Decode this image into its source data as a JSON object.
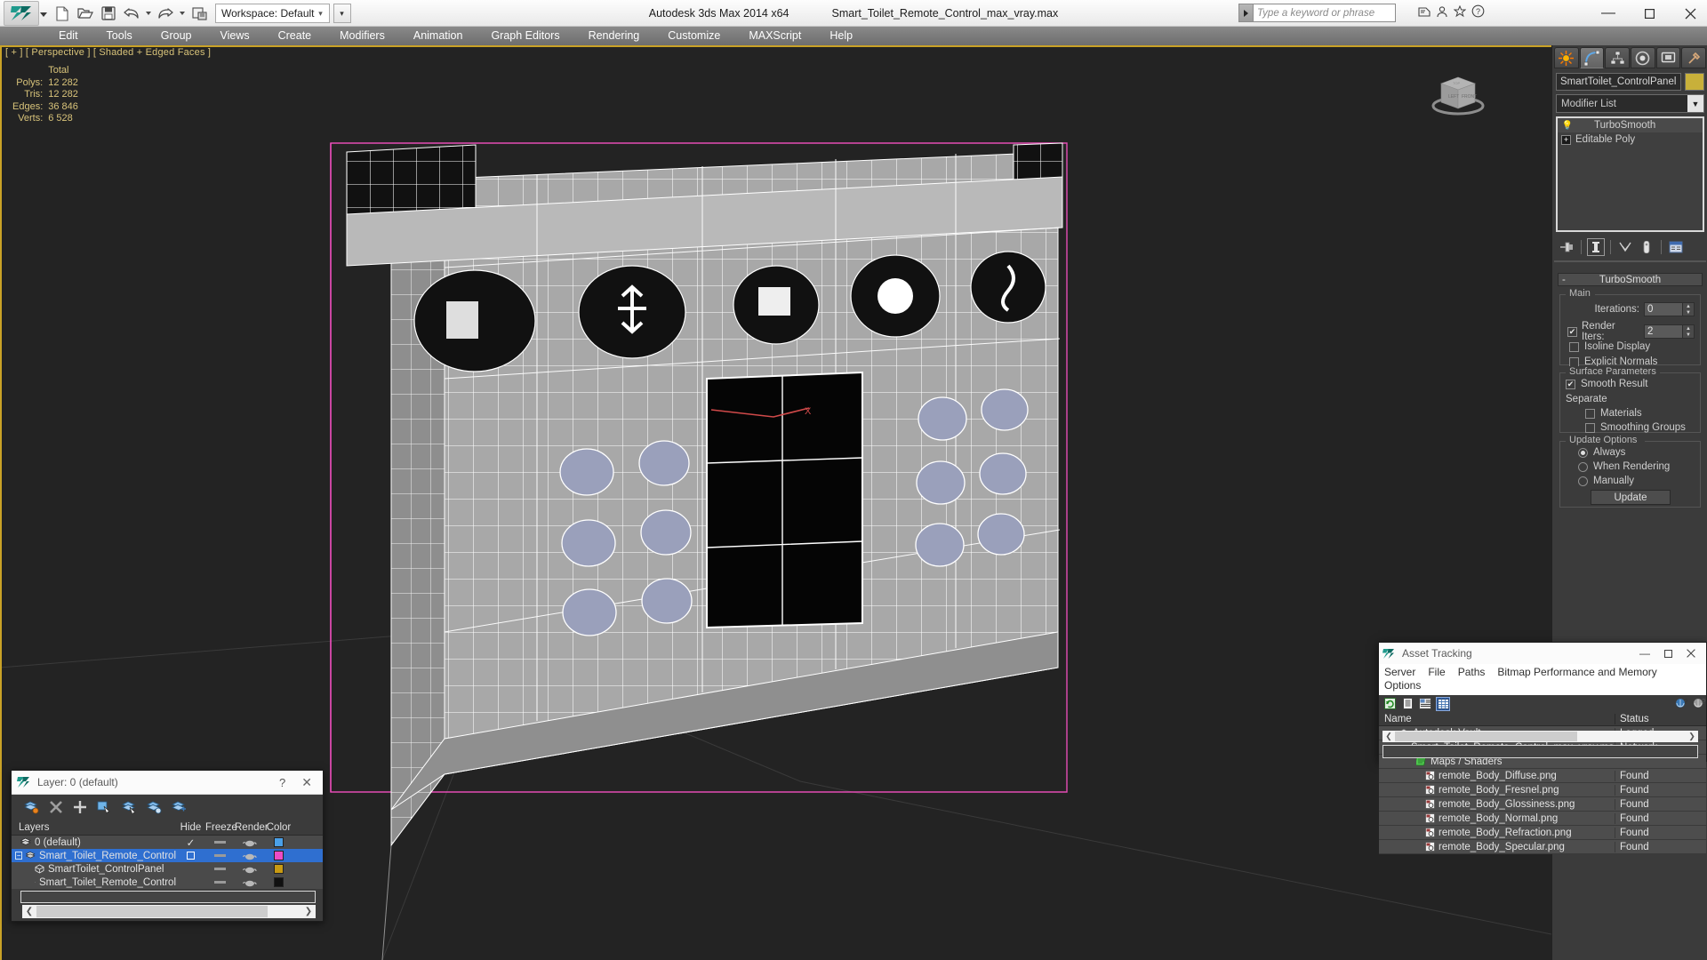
{
  "titlebar": {
    "app_title": "Autodesk 3ds Max  2014 x64",
    "file_title": "Smart_Toilet_Remote_Control_max_vray.max",
    "workspace_label": "Workspace: Default",
    "workspace_dropdown": "▾",
    "workspace_more": "▾",
    "quick_access": [
      {
        "name": "new-file-icon",
        "glyph": "new"
      },
      {
        "name": "open-file-icon",
        "glyph": "open"
      },
      {
        "name": "save-file-icon",
        "glyph": "save"
      },
      {
        "name": "undo-icon",
        "glyph": "undo"
      },
      {
        "name": "undo-dropdown-icon",
        "glyph": "caret"
      },
      {
        "name": "redo-icon",
        "glyph": "redo"
      },
      {
        "name": "redo-dropdown-icon",
        "glyph": "caret"
      },
      {
        "name": "project-folder-icon",
        "glyph": "project"
      }
    ],
    "window_controls": {
      "minimize": "—",
      "maximize": "▭",
      "close": "✕"
    }
  },
  "search": {
    "placeholder": "Type a keyword or phrase",
    "arrow": "▶"
  },
  "menubar": {
    "items": [
      "Edit",
      "Tools",
      "Group",
      "Views",
      "Create",
      "Modifiers",
      "Animation",
      "Graph Editors",
      "Rendering",
      "Customize",
      "MAXScript",
      "Help"
    ]
  },
  "viewport": {
    "label": "[ + ] [ Perspective ] [ Shaded + Edged Faces ]",
    "stats": {
      "header": "Total",
      "rows": [
        {
          "label": "Polys:",
          "value": "12 282"
        },
        {
          "label": "Tris:",
          "value": "12 282"
        },
        {
          "label": "Edges:",
          "value": "36 846"
        },
        {
          "label": "Verts:",
          "value": "6 528"
        }
      ]
    },
    "viewcube": {
      "face_front": "FRONT",
      "face_left": "LEFT",
      "face_top": "TOP"
    },
    "gizmo_axis_label": "X"
  },
  "command_panel": {
    "tabs": [
      {
        "name": "create-tab",
        "icon": "star-icon",
        "active": false
      },
      {
        "name": "modify-tab",
        "icon": "curve-icon",
        "active": true
      },
      {
        "name": "hierarchy-tab",
        "icon": "hierarchy-icon",
        "active": false
      },
      {
        "name": "motion-tab",
        "icon": "wheel-icon",
        "active": false
      },
      {
        "name": "display-tab",
        "icon": "monitor-icon",
        "active": false
      },
      {
        "name": "utilities-tab",
        "icon": "hammer-icon",
        "active": false
      }
    ],
    "object_name": "SmartToilet_ControlPanel",
    "object_color": "#c8b03a",
    "modifier_list_label": "Modifier List",
    "modifier_stack": [
      {
        "label": "TurboSmooth",
        "selected": true,
        "has_expand": false
      },
      {
        "label": "Editable Poly",
        "selected": false,
        "has_expand": true
      }
    ],
    "stack_tools": [
      {
        "name": "pin-stack-icon"
      },
      {
        "name": "show-end-result-icon"
      },
      {
        "name": "make-unique-icon"
      },
      {
        "name": "remove-modifier-icon"
      },
      {
        "name": "configure-modifier-sets-icon"
      }
    ],
    "rollout": {
      "title": "TurboSmooth",
      "collapse_glyph": "-",
      "main": {
        "group_title": "Main",
        "iterations_label": "Iterations:",
        "iterations_value": "0",
        "render_iters_label": "Render Iters:",
        "render_iters_value": "2",
        "render_iters_checked": true,
        "isoline_display_label": "Isoline Display",
        "isoline_display_checked": false,
        "explicit_normals_label": "Explicit Normals",
        "explicit_normals_checked": false
      },
      "surface": {
        "group_title": "Surface Parameters",
        "smooth_result_label": "Smooth Result",
        "smooth_result_checked": true,
        "separate_label": "Separate",
        "materials_label": "Materials",
        "materials_checked": false,
        "smoothing_groups_label": "Smoothing Groups",
        "smoothing_groups_checked": false
      },
      "update": {
        "group_title": "Update Options",
        "always_label": "Always",
        "always_checked": true,
        "when_rendering_label": "When Rendering",
        "when_rendering_checked": false,
        "manually_label": "Manually",
        "manually_checked": false,
        "update_button_label": "Update"
      }
    }
  },
  "layer_dialog": {
    "title": "Layer: 0 (default)",
    "help_glyph": "?",
    "close_glyph": "✕",
    "toolbar": [
      {
        "name": "new-layer-icon"
      },
      {
        "name": "delete-layer-icon"
      },
      {
        "name": "add-selection-to-layer-icon"
      },
      {
        "name": "select-objects-in-layer-icon"
      },
      {
        "name": "highlight-selected-objects-icon"
      },
      {
        "name": "set-current-layer-icon"
      },
      {
        "name": "layer-properties-icon"
      }
    ],
    "columns": [
      "Layers",
      "Hide",
      "Freeze",
      "Render",
      "Color"
    ],
    "rows": [
      {
        "name": "0 (default)",
        "indent": 0,
        "selected": false,
        "current_mark": "✓",
        "color": "#4aa0e8",
        "expand": false
      },
      {
        "name": "Smart_Toilet_Remote_Control",
        "indent": 0,
        "selected": true,
        "current_mark": "□",
        "color": "#ec4bc6",
        "expand": true
      },
      {
        "name": "SmartToilet_ControlPanel",
        "indent": 1,
        "selected": false,
        "current_mark": "",
        "color": "#c89a12",
        "expand": false
      },
      {
        "name": "Smart_Toilet_Remote_Control",
        "indent": 1,
        "selected": false,
        "current_mark": "",
        "color": "#111111",
        "expand": false
      }
    ],
    "scroll": {
      "left_arrow": "❮",
      "right_arrow": "❯"
    }
  },
  "asset_tracking": {
    "title": "Asset Tracking",
    "window_controls": {
      "minimize": "—",
      "maximize": "▭",
      "close": "✕"
    },
    "menus": [
      "Server",
      "File",
      "Paths",
      "Bitmap Performance and Memory",
      "Options"
    ],
    "toolbar": [
      {
        "name": "refresh-icon",
        "active": false
      },
      {
        "name": "list-view-icon",
        "active": false
      },
      {
        "name": "details-view-icon",
        "active": false
      },
      {
        "name": "grid-view-icon",
        "active": true
      },
      {
        "name": "vault-login-icon",
        "active": false
      },
      {
        "name": "vault-logout-icon",
        "active": false
      }
    ],
    "columns": [
      "Name",
      "Status"
    ],
    "rows": [
      {
        "name": "Autodesk Vault",
        "status": "Logged",
        "indent": 0,
        "icon": "vault-icon"
      },
      {
        "name": "Smart_Toilet_Remote_Control_max_vray.max",
        "status": "Network",
        "indent": 1,
        "icon": "max-file-icon"
      },
      {
        "name": "Maps / Shaders",
        "status": "",
        "indent": 2,
        "icon": "maps-icon"
      },
      {
        "name": "remote_Body_Diffuse.png",
        "status": "Found",
        "indent": 3,
        "icon": "bitmap-icon"
      },
      {
        "name": "remote_Body_Fresnel.png",
        "status": "Found",
        "indent": 3,
        "icon": "bitmap-icon"
      },
      {
        "name": "remote_Body_Glossiness.png",
        "status": "Found",
        "indent": 3,
        "icon": "bitmap-icon"
      },
      {
        "name": "remote_Body_Normal.png",
        "status": "Found",
        "indent": 3,
        "icon": "bitmap-icon"
      },
      {
        "name": "remote_Body_Refraction.png",
        "status": "Found",
        "indent": 3,
        "icon": "bitmap-icon"
      },
      {
        "name": "remote_Body_Specular.png",
        "status": "Found",
        "indent": 3,
        "icon": "bitmap-icon"
      }
    ],
    "scroll": {
      "left_arrow": "❮",
      "right_arrow": "❯"
    }
  },
  "colors": {
    "accent_yellow": "#c9a227",
    "selection_pink": "#ef4fbe",
    "panel_bg": "#3b3b3b",
    "viewport_bg": "#232323",
    "selected_row_blue": "#2f6fd0"
  }
}
